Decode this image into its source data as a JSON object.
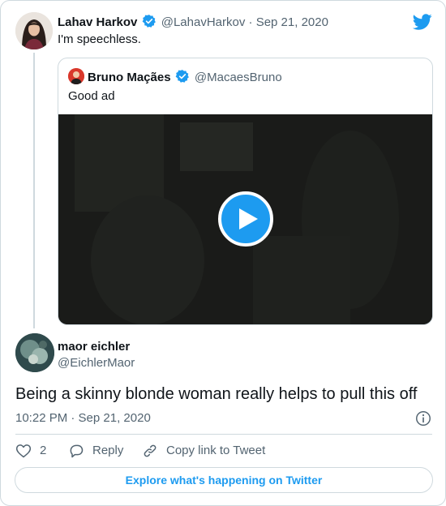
{
  "parent_tweet": {
    "name": "Lahav Harkov",
    "handle": "@LahavHarkov",
    "separator": "·",
    "date": "Sep 21, 2020",
    "text": "I'm speechless."
  },
  "quoted_tweet": {
    "name": "Bruno Maçães",
    "handle": "@MacaesBruno",
    "text": "Good ad",
    "media": {
      "type": "video",
      "play_icon": "play-icon"
    }
  },
  "main_tweet": {
    "name": "maor eichler",
    "handle": "@EichlerMaor",
    "text": "Being a skinny blonde woman really helps to pull this off",
    "timestamp": "10:22 PM · Sep 21, 2020"
  },
  "actions": {
    "like_count": "2",
    "reply_label": "Reply",
    "copy_link_label": "Copy link to Tweet"
  },
  "footer": {
    "explore_label": "Explore what's happening on Twitter"
  },
  "colors": {
    "accent": "#1d9bf0",
    "text": "#0f1419",
    "secondary_text": "#536471",
    "border": "#cfd9de"
  },
  "icons": [
    "twitter-bird-icon",
    "verified-badge-icon",
    "play-icon",
    "info-icon",
    "heart-icon",
    "reply-icon",
    "link-icon"
  ]
}
